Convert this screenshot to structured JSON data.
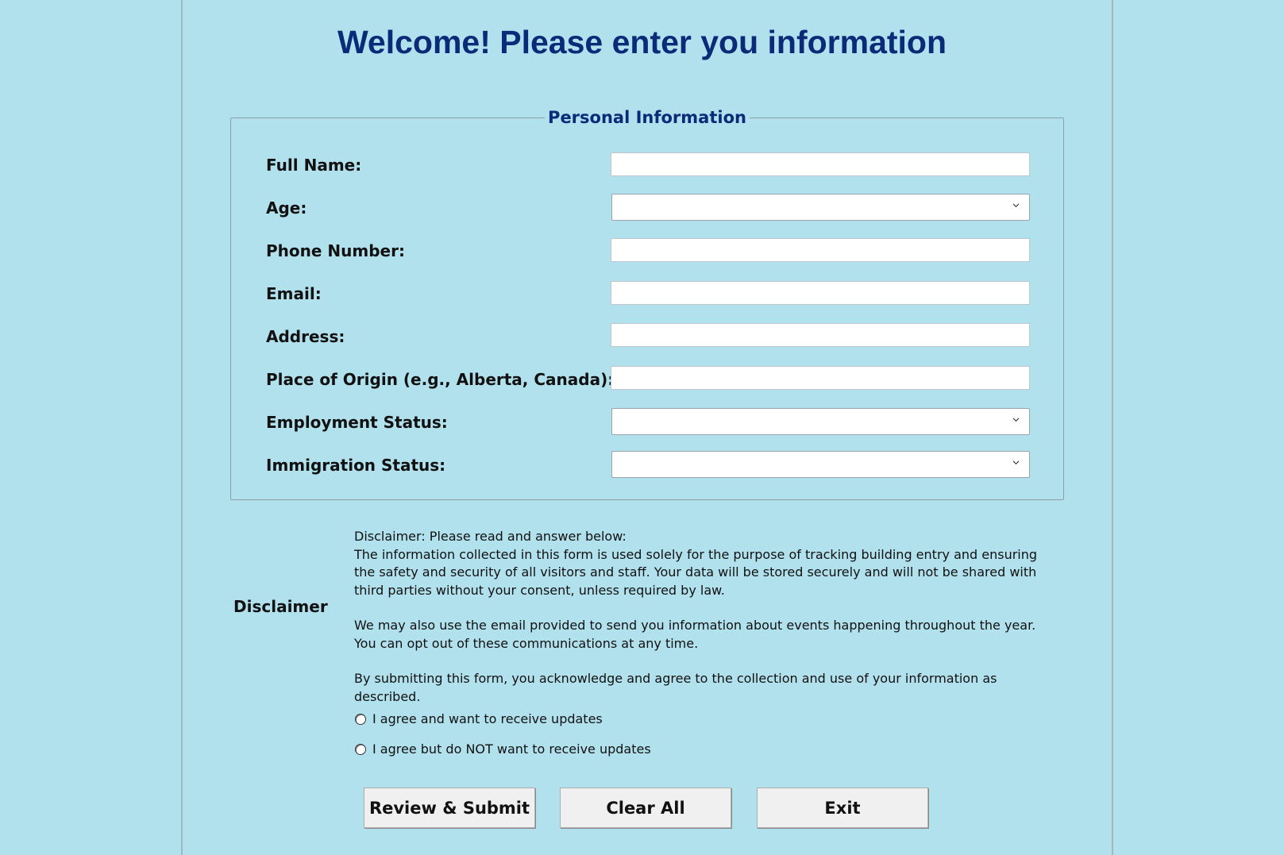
{
  "title": "Welcome! Please enter you information",
  "personal_info": {
    "legend": "Personal Information",
    "fields": {
      "full_name": {
        "label": "Full Name:",
        "value": ""
      },
      "age": {
        "label": "Age:",
        "value": ""
      },
      "phone": {
        "label": "Phone Number:",
        "value": ""
      },
      "email": {
        "label": "Email:",
        "value": ""
      },
      "address": {
        "label": "Address:",
        "value": ""
      },
      "origin": {
        "label": "Place of Origin (e.g., Alberta, Canada):",
        "value": ""
      },
      "employment": {
        "label": "Employment Status:",
        "value": ""
      },
      "immigration": {
        "label": "Immigration Status:",
        "value": ""
      }
    }
  },
  "disclaimer": {
    "label": "Disclaimer",
    "heading": "Disclaimer: Please read and answer below:",
    "paragraph1": "The information collected in this form is used solely for the purpose of tracking building entry and ensuring the safety and security of all visitors and staff. Your data will be stored securely and will not be shared with third parties without your consent, unless required by law.",
    "paragraph2": "We may also use the email provided to send you information about events happening throughout the year. You can opt out of these communications at any time.",
    "paragraph3": "By submitting this form, you acknowledge and agree to the collection and use of your information as described.",
    "options": [
      {
        "label": "I agree and want to receive updates",
        "selected": false
      },
      {
        "label": "I agree but do NOT want to receive updates",
        "selected": false
      }
    ]
  },
  "buttons": {
    "submit": "Review & Submit",
    "clear": "Clear All",
    "exit": "Exit"
  },
  "colors": {
    "background": "#b2e1ee",
    "title": "#0b2a78"
  },
  "icons": {
    "dropdown": "chevron-down-icon",
    "radio": "radio-button-icon"
  }
}
